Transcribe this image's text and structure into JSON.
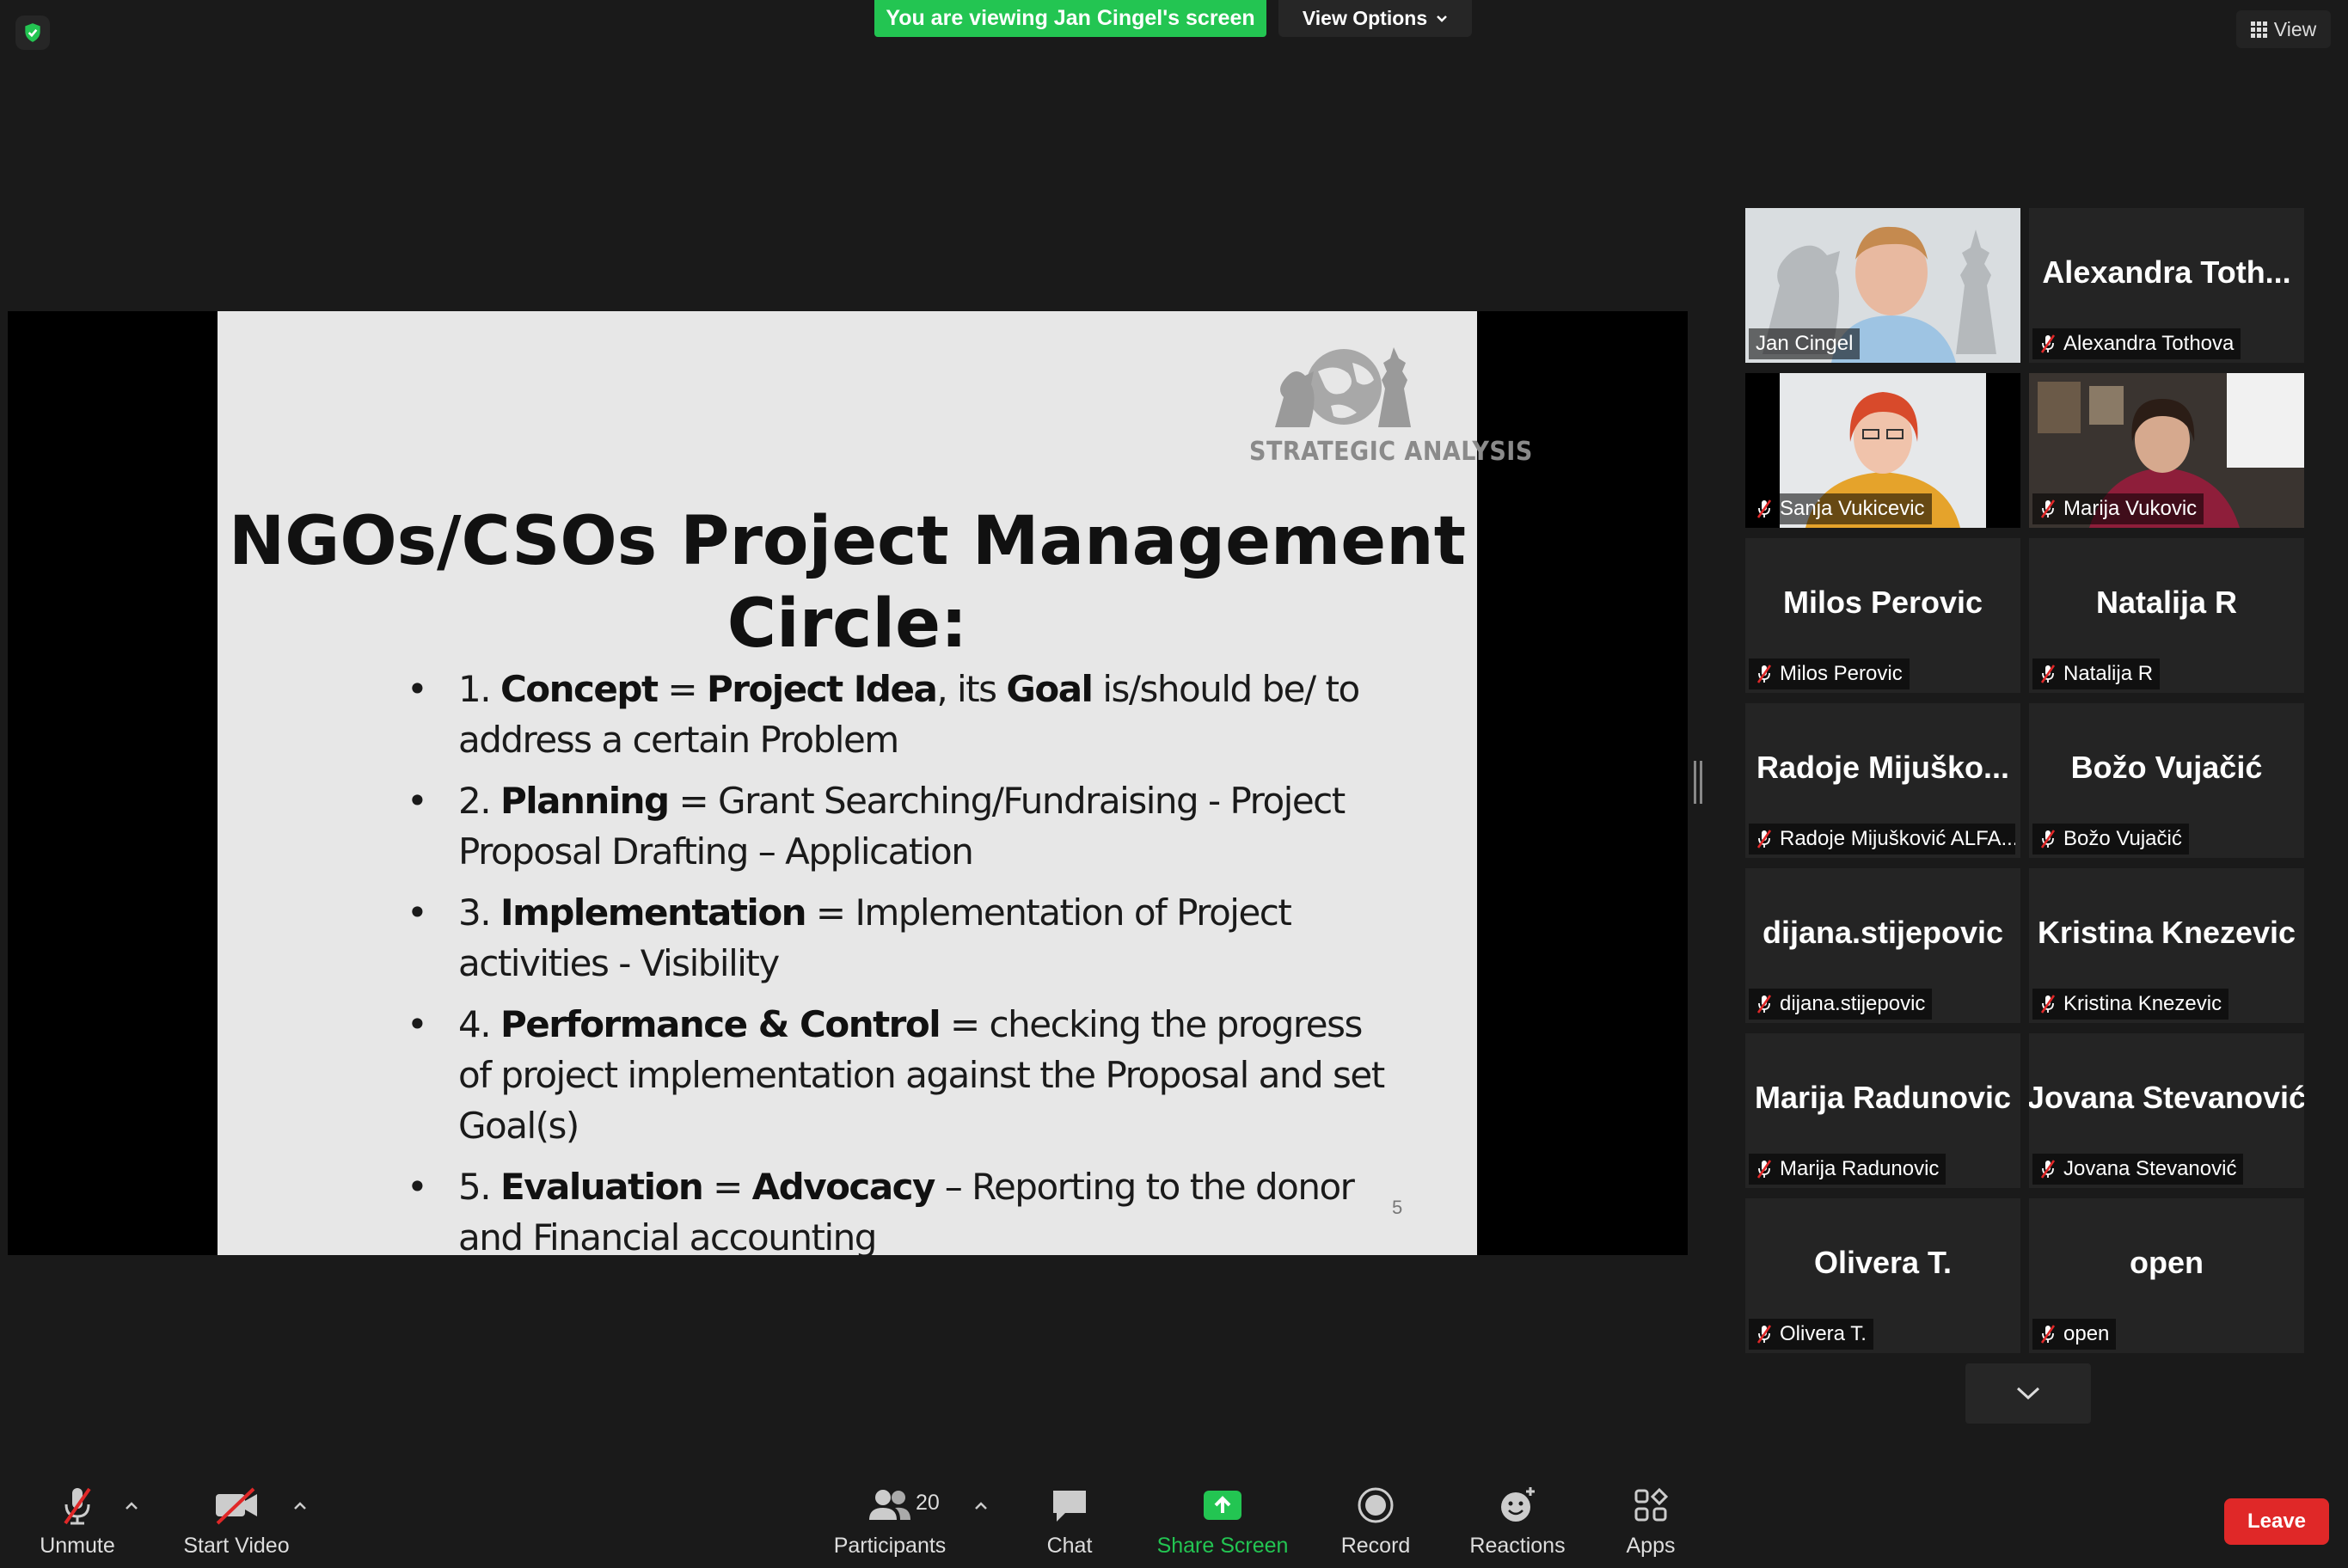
{
  "topbar": {
    "viewing_banner": "You are viewing Jan Cingel's screen",
    "view_options": "View Options",
    "view_button": "View"
  },
  "slide": {
    "logo_text": "STRATEGIC ANALYSIS",
    "title_line1": "NGOs/CSOs Project Management",
    "title_line2": "Circle:",
    "bullets": [
      {
        "num": "1. ",
        "bold1": "Concept",
        "mid1": " = ",
        "bold2": "Project Idea",
        "mid2": ", its ",
        "bold3": "Goal",
        "rest": " is/should be/ to address a certain Problem"
      },
      {
        "num": "2. ",
        "bold1": "Planning",
        "rest": " = Grant Searching/Fundraising - Project Proposal Drafting – Application"
      },
      {
        "num": "3. ",
        "bold1": "Implementation",
        "rest": " = Implementation of Project activities - Visibility"
      },
      {
        "num": "4. ",
        "bold1": "Performance & Control",
        "rest": " = checking the progress of project implementation against the Proposal and set Goal(s)"
      },
      {
        "num": "5. ",
        "bold1": "Evaluation",
        "mid1": " = ",
        "bold2": "Advocacy",
        "rest": " – Reporting  to the donor and Financial accounting"
      }
    ],
    "page_number": "5"
  },
  "participants": [
    {
      "big": "",
      "label": "Jan Cingel",
      "video": true
    },
    {
      "big": "Alexandra  Toth...",
      "label": "Alexandra Tothova",
      "video": false
    },
    {
      "big": "",
      "label": "Sanja Vukicevic",
      "video": true
    },
    {
      "big": "",
      "label": "Marija Vukovic",
      "video": true
    },
    {
      "big": "Milos Perovic",
      "label": "Milos Perovic",
      "video": false
    },
    {
      "big": "Natalija R",
      "label": "Natalija R",
      "video": false
    },
    {
      "big": "Radoje  Mijuško...",
      "label": "Radoje Mijušković ALFA...",
      "video": false
    },
    {
      "big": "Božo Vujačić",
      "label": "Božo Vujačić",
      "video": false
    },
    {
      "big": "dijana.stijepovic",
      "label": "dijana.stijepovic",
      "video": false
    },
    {
      "big": "Kristina Knezevic",
      "label": "Kristina Knezevic",
      "video": false
    },
    {
      "big": "Marija Radunovic",
      "label": "Marija Radunovic",
      "video": false
    },
    {
      "big": "Jovana Stevanović",
      "label": "Jovana Stevanović",
      "video": false
    },
    {
      "big": "Olivera T.",
      "label": "Olivera T.",
      "video": false
    },
    {
      "big": "open",
      "label": "open",
      "video": false
    }
  ],
  "toolbar": {
    "unmute": "Unmute",
    "start_video": "Start Video",
    "participants": "Participants",
    "participant_count": "20",
    "chat": "Chat",
    "share_screen": "Share Screen",
    "record": "Record",
    "reactions": "Reactions",
    "apps": "Apps",
    "leave": "Leave"
  },
  "colors": {
    "accent_green": "#23c552",
    "leave_red": "#e02828",
    "active_speaker": "#d5ef3a"
  }
}
